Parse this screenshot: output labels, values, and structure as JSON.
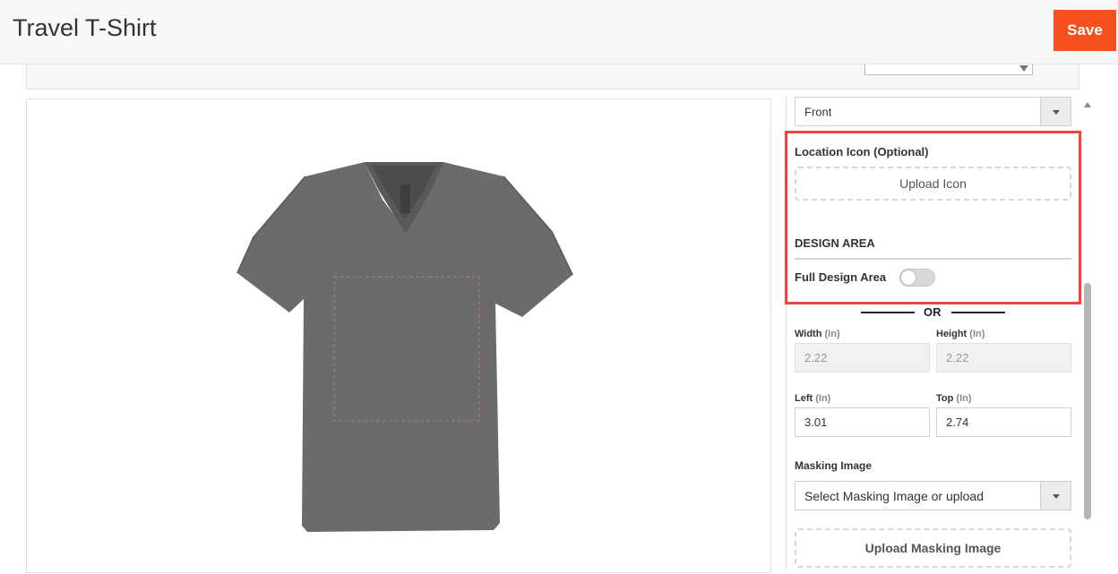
{
  "header": {
    "title": "Travel T-Shirt",
    "save_label": "Save"
  },
  "canvas": {
    "product_icon": "v-neck-tshirt",
    "shirt_color": "#6b6b6b"
  },
  "panel": {
    "side_select": {
      "value": "Front"
    },
    "location_icon": {
      "label": "Location Icon (Optional)",
      "upload_label": "Upload  Icon"
    },
    "design_area": {
      "heading": "DESIGN AREA",
      "full_design_label": "Full Design Area",
      "full_design_on": false,
      "or_text": "OR"
    },
    "dimensions": {
      "width_label": "Width",
      "height_label": "Height",
      "left_label": "Left",
      "top_label": "Top",
      "unit": "(In)",
      "width_value": "2.22",
      "height_value": "2.22",
      "left_value": "3.01",
      "top_value": "2.74"
    },
    "masking": {
      "label": "Masking Image",
      "select_value": "Select Masking Image or upload",
      "upload_label": "Upload Masking Image"
    }
  },
  "colors": {
    "accent": "#f5501d",
    "highlight": "#e84848"
  }
}
